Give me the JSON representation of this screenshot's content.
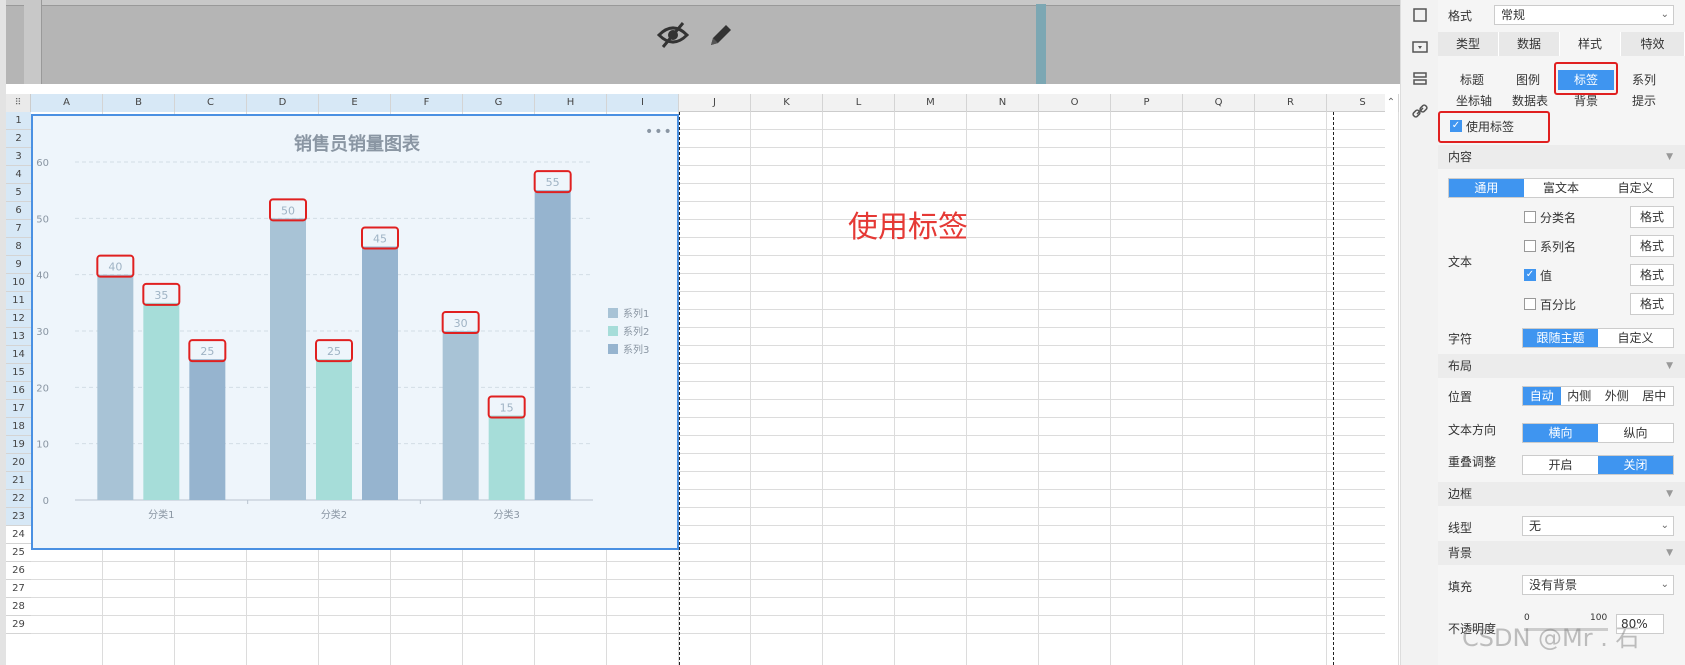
{
  "columns": [
    "A",
    "B",
    "C",
    "D",
    "E",
    "F",
    "G",
    "H",
    "I",
    "J",
    "K",
    "L",
    "M",
    "N",
    "O",
    "P",
    "Q",
    "R",
    "S"
  ],
  "rows": [
    "1",
    "2",
    "3",
    "4",
    "5",
    "6",
    "7",
    "8",
    "9",
    "10",
    "11",
    "12",
    "13",
    "14",
    "15",
    "16",
    "17",
    "18",
    "19",
    "20",
    "21",
    "22",
    "23",
    "24",
    "25",
    "26",
    "27",
    "28",
    "29"
  ],
  "annotation": "使用标签",
  "chart_data": {
    "type": "bar",
    "title": "销售员销量图表",
    "categories": [
      "分类1",
      "分类2",
      "分类3"
    ],
    "series": [
      {
        "name": "系列1",
        "values": [
          40,
          50,
          30
        ],
        "color": "#a8c3d6"
      },
      {
        "name": "系列2",
        "values": [
          35,
          25,
          15
        ],
        "color": "#a6ddd9"
      },
      {
        "name": "系列3",
        "values": [
          25,
          45,
          55
        ],
        "color": "#96b4cf"
      }
    ],
    "ylim": [
      0,
      60
    ],
    "yticks": [
      0,
      10,
      20,
      30,
      40,
      50,
      60
    ],
    "data_labels": true,
    "legend_position": "right",
    "grid": true
  },
  "panel": {
    "format_label": "格式",
    "format_value": "常规",
    "main_tabs": [
      "类型",
      "数据",
      "样式",
      "特效"
    ],
    "active_main_tab": "样式",
    "sub_tabs_row1": [
      "标题",
      "图例",
      "标签",
      "系列"
    ],
    "sub_tabs_row2": [
      "坐标轴",
      "数据表",
      "背景",
      "提示"
    ],
    "active_sub_tab": "标签",
    "use_label": "使用标签",
    "content_section": "内容",
    "content_modes": [
      "通用",
      "富文本",
      "自定义"
    ],
    "text_label": "文本",
    "text_options": [
      {
        "label": "分类名",
        "checked": false
      },
      {
        "label": "系列名",
        "checked": false
      },
      {
        "label": "值",
        "checked": true
      },
      {
        "label": "百分比",
        "checked": false
      }
    ],
    "format_btn": "格式",
    "char_label": "字符",
    "char_modes": [
      "跟随主题",
      "自定义"
    ],
    "layout_section": "布局",
    "position_label": "位置",
    "position_modes": [
      "自动",
      "内侧",
      "外侧",
      "居中"
    ],
    "direction_label": "文本方向",
    "direction_modes": [
      "横向",
      "纵向"
    ],
    "overlap_label": "重叠调整",
    "overlap_modes": [
      "开启",
      "关闭"
    ],
    "border_section": "边框",
    "line_type_label": "线型",
    "line_type_value": "无",
    "background_section": "背景",
    "fill_label": "填充",
    "fill_value": "没有背景",
    "opacity_label": "不透明度",
    "opacity_min": "0",
    "opacity_max": "100",
    "opacity_value": "80%"
  },
  "watermark": "CSDN @Mr . 石"
}
